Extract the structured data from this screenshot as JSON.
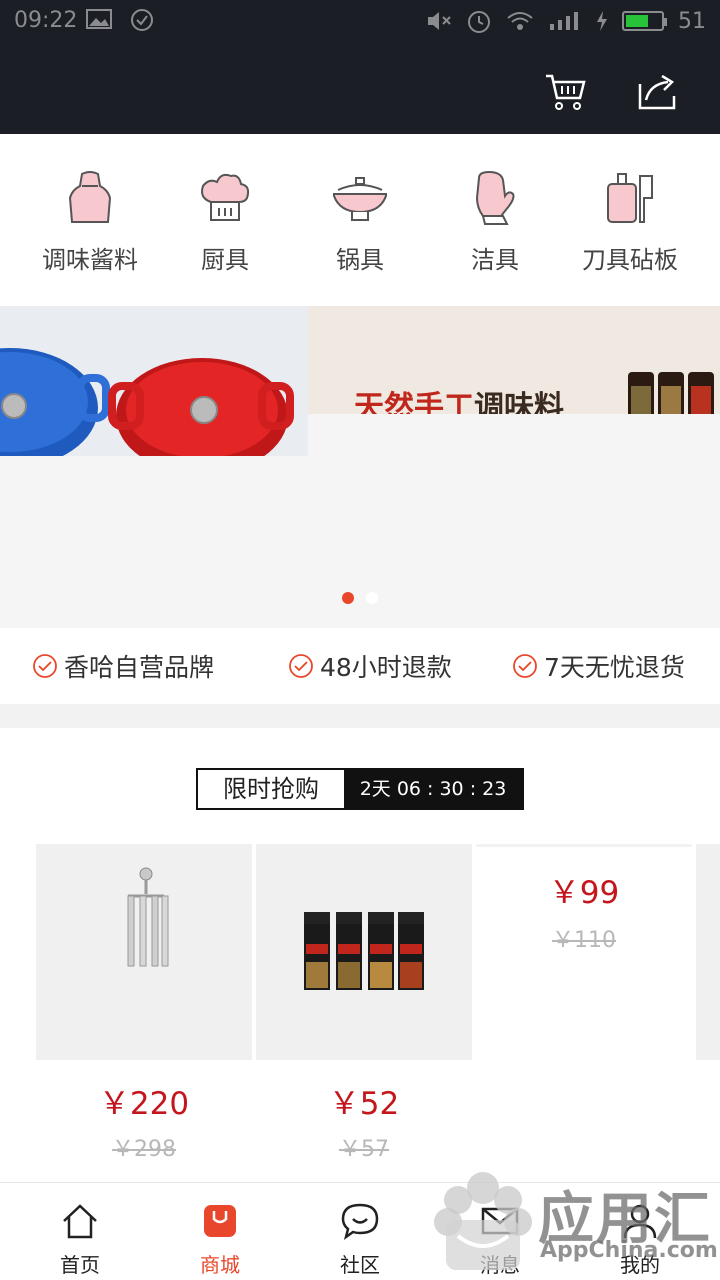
{
  "status_bar": {
    "time": "09:22",
    "battery": "51"
  },
  "header": {
    "cart_icon": "cart-icon",
    "share_icon": "share-icon"
  },
  "categories": [
    {
      "label": "调味酱料",
      "icon": "apron-icon"
    },
    {
      "label": "厨具",
      "icon": "chef-hat-icon"
    },
    {
      "label": "锅具",
      "icon": "pot-icon"
    },
    {
      "label": "洁具",
      "icon": "glove-icon"
    },
    {
      "label": "刀具砧板",
      "icon": "knife-board-icon"
    }
  ],
  "banner": {
    "slide2_text_red": "天然手工",
    "slide2_text_dark": "调味料",
    "active_dot": 0,
    "dot_count": 2
  },
  "guarantees": [
    {
      "label": "香哈自营品牌"
    },
    {
      "label": "48小时退款"
    },
    {
      "label": "7天无忧退货"
    }
  ],
  "flash_sale": {
    "title": "限时抢购",
    "countdown": "2天 06 : 30 : 23",
    "products": [
      {
        "price": "￥220",
        "old_price": "￥298"
      },
      {
        "price": "￥52",
        "old_price": "￥57"
      },
      {
        "price": "￥99",
        "old_price": "￥110"
      }
    ]
  },
  "nav": [
    {
      "label": "首页",
      "icon": "home-icon"
    },
    {
      "label": "商城",
      "icon": "shop-bag-icon"
    },
    {
      "label": "社区",
      "icon": "chat-bubble-icon"
    },
    {
      "label": "消息",
      "icon": "mail-icon"
    },
    {
      "label": "我的",
      "icon": "profile-icon"
    }
  ],
  "watermark": {
    "title": "应用汇",
    "subtitle": "AppChina.com"
  },
  "colors": {
    "accent": "#e8472c",
    "price": "#c4161c",
    "header_bg": "#1b1e24",
    "icon_pink": "#f7c9cf"
  }
}
